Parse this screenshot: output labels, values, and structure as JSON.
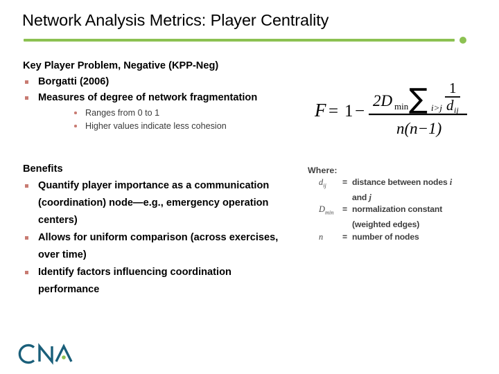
{
  "slide": {
    "title": "Network Analysis Metrics: Player Centrality",
    "accent_color": "#8cc152",
    "bullet_color": "#c87b72",
    "text_color": "#000000",
    "legend_text_color": "#3f3f3f"
  },
  "kpp": {
    "heading": "Key Player Problem, Negative (KPP-Neg)",
    "bullets": [
      {
        "text": "Borgatti (2006)",
        "sub": []
      },
      {
        "text": "Measures of degree of network fragmentation",
        "sub": [
          "Ranges from 0 to 1",
          "Higher values indicate less cohesion"
        ]
      }
    ]
  },
  "benefits": {
    "heading": "Benefits",
    "bullets": [
      "Quantify player importance as a communication (coordination) node—e.g., emergency operation centers)",
      "Allows for uniform comparison (across exercises, over time)",
      "Identify factors influencing coordination performance"
    ]
  },
  "formula": {
    "lhs": "F",
    "equals": "=",
    "one": "1",
    "minus": "−",
    "numerator_coefficient": "2D",
    "numerator_coefficient_sub": "min",
    "sum_symbol": "∑",
    "sum_index": "i>j",
    "fraction_numerator": "1",
    "fraction_denominator": "d",
    "fraction_denominator_sub": "ij",
    "denominator": "n(n−1)",
    "plain_text": "F = 1 − ( 2D_min ∑_{i>j} 1/d_ij ) / ( n(n−1) )"
  },
  "where": {
    "title": "Where:",
    "rows": [
      {
        "symbol": "d",
        "symbol_sub": "ij",
        "equals": "=",
        "definition": "distance between nodes ",
        "definition_italic": "i",
        "continuation": "and ",
        "continuation_italic": "j"
      },
      {
        "symbol": "D",
        "symbol_sub": "min",
        "equals": "=",
        "definition": "normalization constant",
        "definition_italic": "",
        "continuation": "(weighted edges)",
        "continuation_italic": ""
      },
      {
        "symbol": "n",
        "symbol_sub": "",
        "equals": "=",
        "definition": "number of nodes",
        "definition_italic": "",
        "continuation": "",
        "continuation_italic": ""
      }
    ]
  },
  "logo": {
    "text": "CNA",
    "wordmark_color": "#1a5f7a",
    "dot_color": "#8cc152"
  }
}
